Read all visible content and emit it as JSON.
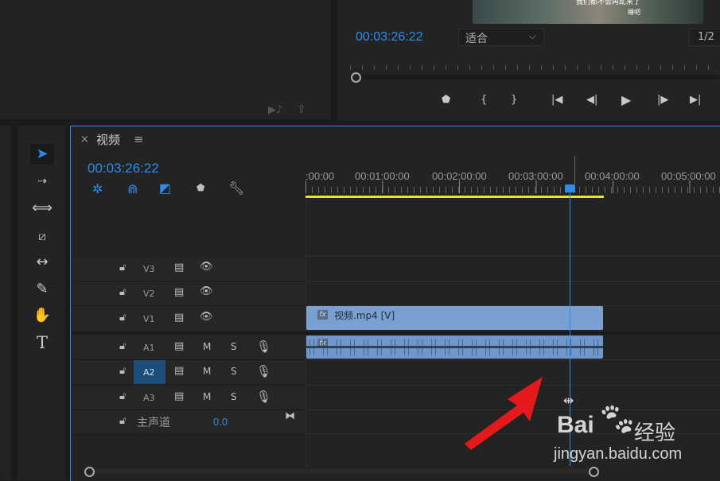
{
  "program_monitor": {
    "timecode": "00:03:26:22",
    "fit_select": "适合",
    "resolution": "1/2",
    "video_caption_1": "我们都不会再乱来了",
    "video_caption_2": "睡吧"
  },
  "timeline": {
    "tab_close": "×",
    "tab_title": "视频",
    "tab_menu": "≡",
    "timecode": "00:03:26:22",
    "ruler_labels": [
      ":00:00",
      "00:01:00:00",
      "00:02:00:00",
      "00:03:00:00",
      "00:04:00:00",
      "00:05:00:00"
    ],
    "video_tracks": [
      "V3",
      "V2",
      "V1"
    ],
    "audio_tracks": [
      "A1",
      "A2",
      "A3"
    ],
    "mute_label": "M",
    "solo_label": "S",
    "master_label": "主声道",
    "master_value": "0.0",
    "video_clip_label": "视频.mp4 [V]",
    "fx_label": "fx"
  },
  "watermark": {
    "brand": "Bai",
    "brand_cn": "经验",
    "url": "jingyan.baidu.com"
  },
  "colors": {
    "accent": "#2d8ceb",
    "clip_video": "#7aa0d2",
    "clip_audio": "#6f97cb",
    "work_area": "#e6e61e",
    "arrow": "#e3191c"
  }
}
